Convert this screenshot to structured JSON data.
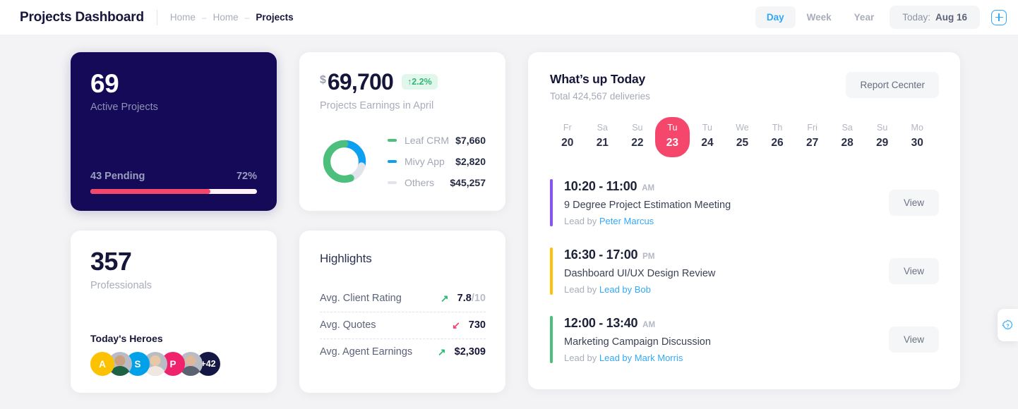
{
  "header": {
    "brand": "Projects Dashboard",
    "breadcrumbs": [
      {
        "label": "Home",
        "active": false
      },
      {
        "label": "Home",
        "active": false
      },
      {
        "label": "Projects",
        "active": true
      }
    ],
    "separator": "–",
    "segments": [
      {
        "label": "Day",
        "active": true
      },
      {
        "label": "Week",
        "active": false
      },
      {
        "label": "Year",
        "active": false
      }
    ],
    "today_label": "Today:",
    "today_value": "Aug 16",
    "add_button_icon": "plus-icon"
  },
  "active_projects": {
    "count": "69",
    "label": "Active Projects",
    "pending_label": "43 Pending",
    "percent_label": "72%",
    "percent_value": 72,
    "bar_color": "#f4476b",
    "card_color": "#150a58"
  },
  "professionals": {
    "count": "357",
    "label": "Professionals",
    "heroes_title": "Today's Heroes",
    "avatars": [
      {
        "type": "initial",
        "label": "A",
        "color": "#fcc202"
      },
      {
        "type": "photo",
        "label": ""
      },
      {
        "type": "initial",
        "label": "S",
        "color": "#00a1e8"
      },
      {
        "type": "photo",
        "label": ""
      },
      {
        "type": "initial",
        "label": "P",
        "color": "#f0226b"
      },
      {
        "type": "photo",
        "label": ""
      },
      {
        "type": "more",
        "label": "+42",
        "color": "#141744"
      }
    ]
  },
  "earnings": {
    "currency": "$",
    "amount": "69,700",
    "change_badge": "↑2.2%",
    "badge_color": "#2fb776",
    "subtitle": "Projects Earnings in April",
    "chart_data": {
      "type": "pie",
      "title": "Projects Earnings in April",
      "categories": [
        "Leaf CRM",
        "Mivy App",
        "Others"
      ],
      "values": [
        7660,
        2820,
        45257
      ],
      "value_labels": [
        "$7,660",
        "$2,820",
        "$45,257"
      ],
      "colors": [
        "#4bbf7b",
        "#0d9ff0",
        "#e2e4ec"
      ],
      "legend": "right",
      "arc_degrees": [
        200,
        105,
        55
      ]
    }
  },
  "highlights": {
    "title": "Highlights",
    "rows": [
      {
        "label": "Avg. Client Rating",
        "trend": "up",
        "arrow": "↗",
        "value": "7.8",
        "denominator": "/10"
      },
      {
        "label": "Avg. Quotes",
        "trend": "down",
        "arrow": "↙",
        "value": "730",
        "denominator": ""
      },
      {
        "label": "Avg. Agent Earnings",
        "trend": "up",
        "arrow": "↗",
        "value": "$2,309",
        "denominator": ""
      }
    ]
  },
  "whats_up": {
    "title": "What’s up Today",
    "subtitle": "Total 424,567 deliveries",
    "report_button": "Report Cecnter",
    "days": [
      {
        "weekday": "Fr",
        "date": "20",
        "active": false
      },
      {
        "weekday": "Sa",
        "date": "21",
        "active": false
      },
      {
        "weekday": "Su",
        "date": "22",
        "active": false
      },
      {
        "weekday": "Tu",
        "date": "23",
        "active": true
      },
      {
        "weekday": "Tu",
        "date": "24",
        "active": false
      },
      {
        "weekday": "We",
        "date": "25",
        "active": false
      },
      {
        "weekday": "Th",
        "date": "26",
        "active": false
      },
      {
        "weekday": "Fri",
        "date": "27",
        "active": false
      },
      {
        "weekday": "Sa",
        "date": "28",
        "active": false
      },
      {
        "weekday": "Su",
        "date": "29",
        "active": false
      },
      {
        "weekday": "Mo",
        "date": "30",
        "active": false
      }
    ],
    "events": [
      {
        "time": "10:20 - 11:00",
        "meridiem": "AM",
        "title": "9 Degree Project Estimation Meeting",
        "lead_prefix": "Lead by",
        "lead_name": "Peter Marcus",
        "accent": "#8950fc",
        "action": "View"
      },
      {
        "time": "16:30 - 17:00",
        "meridiem": "PM",
        "title": "Dashboard UI/UX Design Review",
        "lead_prefix": "Lead by",
        "lead_name": "Lead by Bob",
        "accent": "#ffc107",
        "action": "View"
      },
      {
        "time": "12:00 - 13:40",
        "meridiem": "AM",
        "title": "Marketing Campaign Discussion",
        "lead_prefix": "Lead by",
        "lead_name": "Lead by Mark Morris",
        "accent": "#4bbf7b",
        "action": "View"
      }
    ]
  },
  "help": {
    "icon": "question-badge-icon",
    "color": "#2fa8f7"
  }
}
